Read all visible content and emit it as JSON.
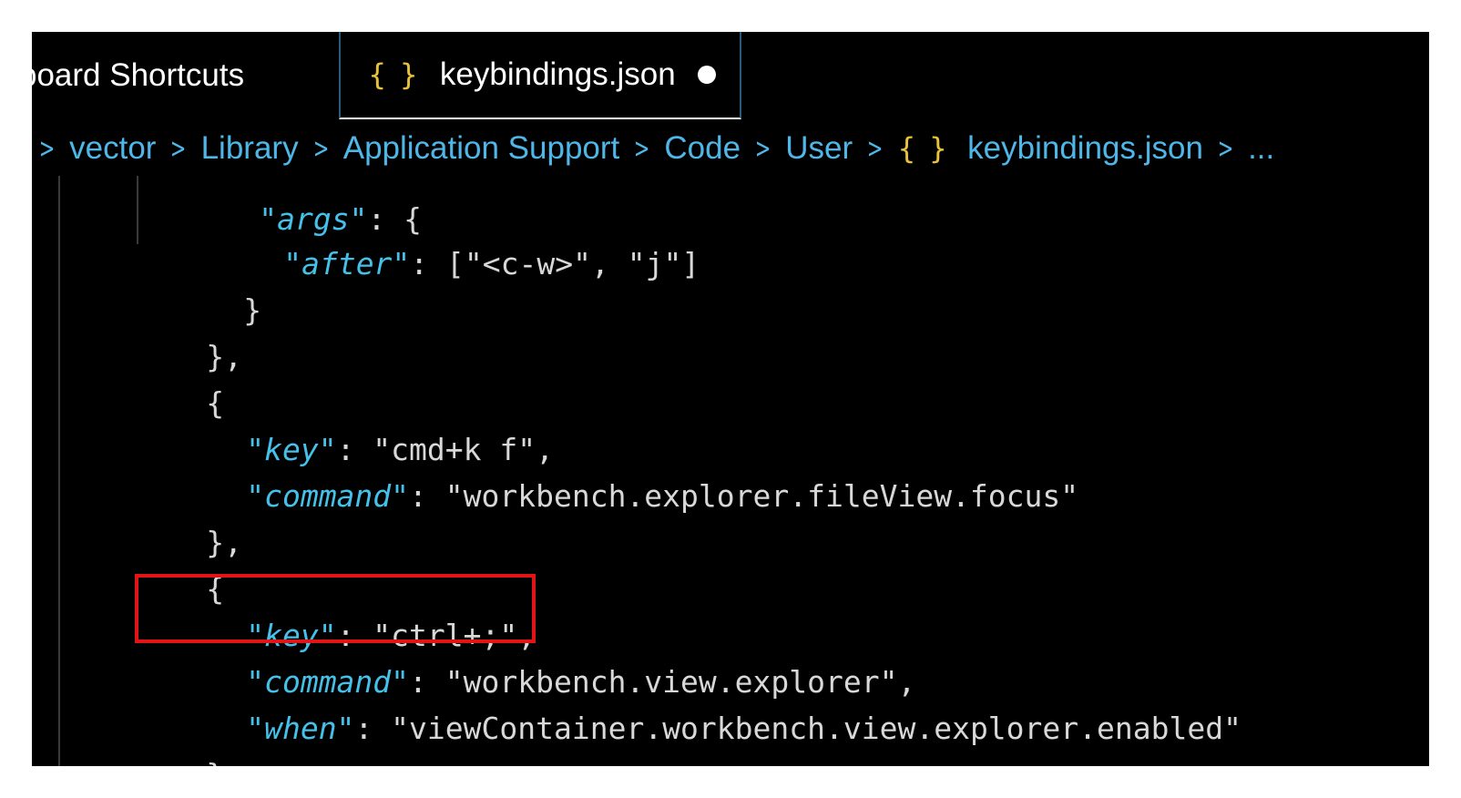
{
  "tabs": [
    {
      "label": "board Shortcuts",
      "active": false
    },
    {
      "label": "keybindings.json",
      "active": true,
      "icon": "json-braces-icon",
      "dirty": true
    }
  ],
  "tab_icon_text": "{ }",
  "breadcrumb": {
    "items": [
      "vector",
      "Library",
      "Application Support",
      "Code",
      "User",
      "keybindings.json",
      "..."
    ],
    "file_icon_text": "{ }"
  },
  "code": {
    "line_args_key": "\"args\"",
    "line_args_rest": ": {",
    "after_key": "\"after\"",
    "after_value": ": [\"<c-w>\", \"j\"]",
    "close_brace": "}",
    "close_obj_comma": "},",
    "open_brace": "{",
    "entry1_key_key": "\"key\"",
    "entry1_key_value": ": \"cmd+k f\",",
    "entry1_command_key": "\"command\"",
    "entry1_command_value": ": \"workbench.explorer.fileView.focus\"",
    "entry2_key_key": "\"key\"",
    "entry2_key_value": ": \"ctrl+;\",",
    "entry2_command_key": "\"command\"",
    "entry2_command_value": ": \"workbench.view.explorer\",",
    "entry2_when_key": "\"when\"",
    "entry2_when_value": ": \"viewContainer.workbench.view.explorer.enabled\""
  },
  "colors": {
    "background": "#000000",
    "property_key": "#45c0e8",
    "breadcrumb": "#4fb6e8",
    "json_icon": "#e7c23a",
    "highlight": "#e11515"
  }
}
